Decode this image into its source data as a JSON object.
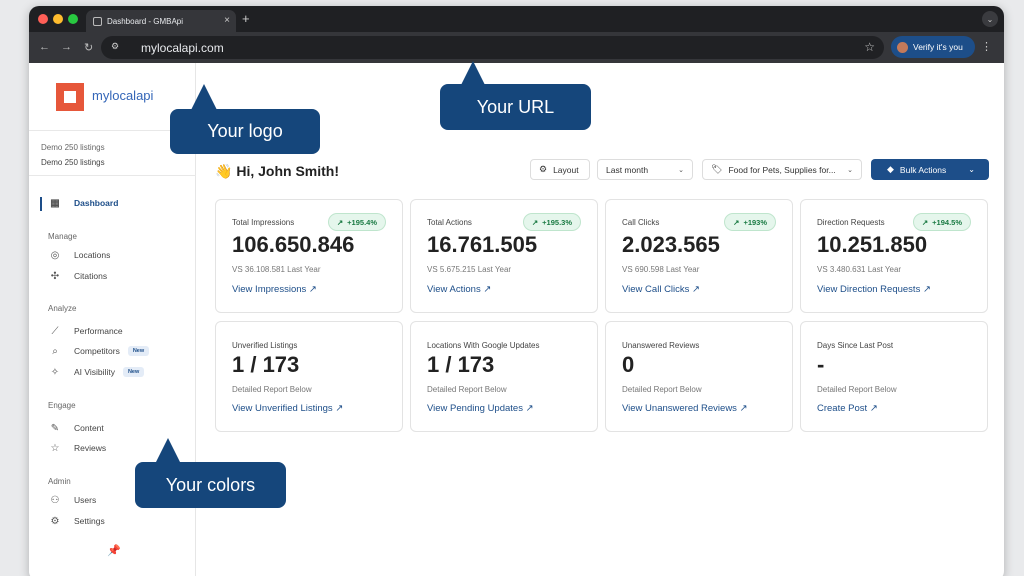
{
  "browser": {
    "tab_title": "Dashboard - GMBApi",
    "tab_close": "×",
    "new_tab": "+",
    "url": "mylocalapi.com",
    "verify_label": "Verify it's you"
  },
  "sidebar": {
    "logo_text": "mylocalapi",
    "org_line1": "Demo 250 listings",
    "org_line2": "Demo 250 listings",
    "dashboard": "Dashboard",
    "manage_head": "Manage",
    "locations": "Locations",
    "citations": "Citations",
    "analyze_head": "Analyze",
    "performance": "Performance",
    "competitors": "Competitors",
    "competitors_badge": "New",
    "ai_visibility": "AI Visibility",
    "ai_badge": "New",
    "engage_head": "Engage",
    "content": "Content",
    "reviews": "Reviews",
    "admin_head": "Admin",
    "users": "Users",
    "settings": "Settings"
  },
  "header": {
    "greeting": "Hi, John Smith!",
    "greeting_emoji": "👋",
    "layout_label": "Layout",
    "period_value": "Last month",
    "category_value": "Food for Pets, Supplies for...",
    "bulk_label": "Bulk Actions"
  },
  "stats": [
    {
      "title": "Total Impressions",
      "value": "106.650.846",
      "delta": "+195.4%",
      "sub": "VS 36.108.581 Last Year",
      "link": "View Impressions"
    },
    {
      "title": "Total Actions",
      "value": "16.761.505",
      "delta": "+195.3%",
      "sub": "VS 5.675.215 Last Year",
      "link": "View Actions"
    },
    {
      "title": "Call Clicks",
      "value": "2.023.565",
      "delta": "+193%",
      "sub": "VS 690.598 Last Year",
      "link": "View Call Clicks"
    },
    {
      "title": "Direction Requests",
      "value": "10.251.850",
      "delta": "+194.5%",
      "sub": "VS 3.480.631 Last Year",
      "link": "View Direction Requests"
    }
  ],
  "reports": [
    {
      "title": "Unverified Listings",
      "value": "1 / 173",
      "sub": "Detailed Report Below",
      "link": "View Unverified Listings"
    },
    {
      "title": "Locations With Google Updates",
      "value": "1 / 173",
      "sub": "Detailed Report Below",
      "link": "View Pending Updates"
    },
    {
      "title": "Unanswered Reviews",
      "value": "0",
      "sub": "Detailed Report Below",
      "link": "View Unanswered Reviews"
    },
    {
      "title": "Days Since Last Post",
      "value": "-",
      "sub": "Detailed Report Below",
      "link": "Create Post"
    }
  ],
  "callouts": {
    "logo": "Your logo",
    "url": "Your URL",
    "colors": "Your colors"
  },
  "colors": {
    "brand_blue": "#1d4e89",
    "callout_bg": "#15467b",
    "logo_orange": "#e6573a",
    "positive_green": "#1a7a43"
  },
  "icons": {
    "arrow": "↗",
    "trend": "↗"
  }
}
